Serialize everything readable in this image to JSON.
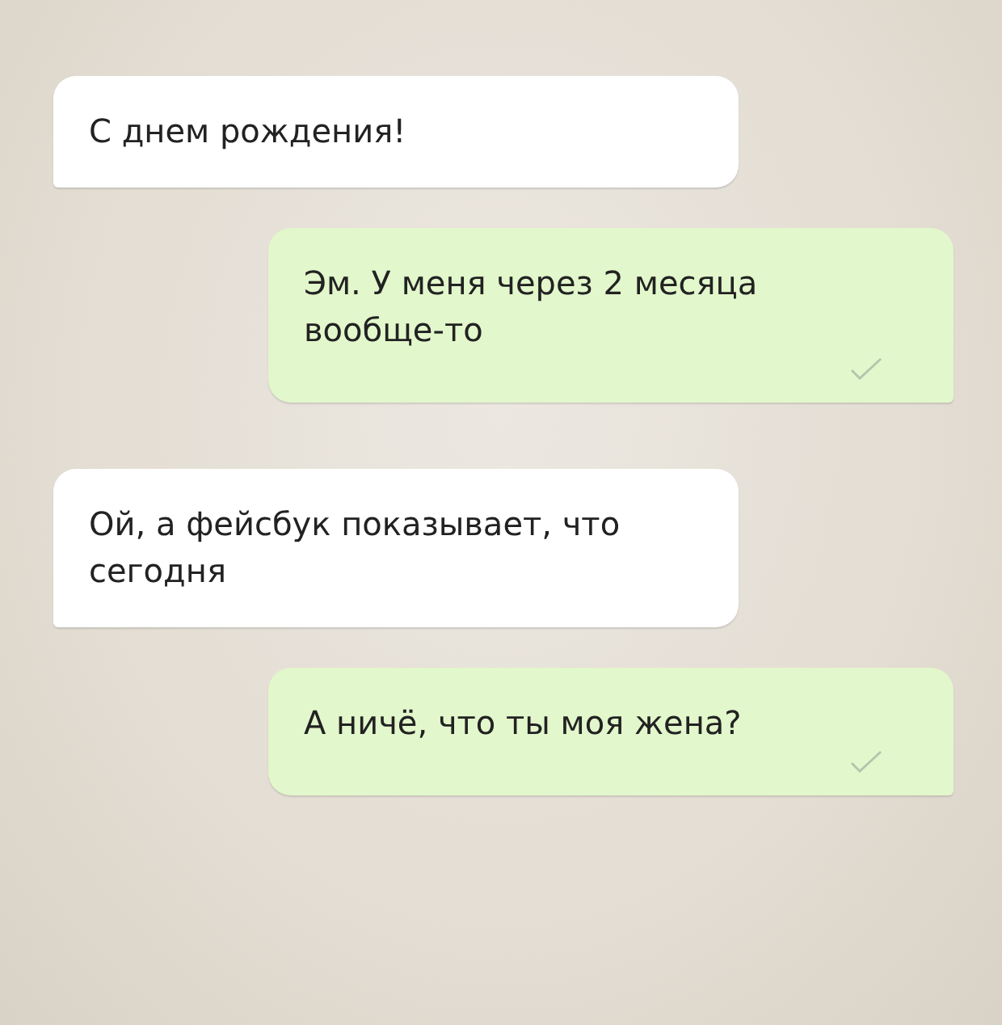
{
  "messages": [
    {
      "kind": "incoming",
      "text": "С днем рождения!"
    },
    {
      "kind": "outgoing",
      "text": "Эм. У меня через 2 месяца вообще-то",
      "sent": true
    },
    {
      "kind": "incoming",
      "text": "Ой, а фейсбук показывает, что сегодня"
    },
    {
      "kind": "outgoing",
      "text": "А ничё, что ты моя жена?",
      "sent": true
    }
  ]
}
